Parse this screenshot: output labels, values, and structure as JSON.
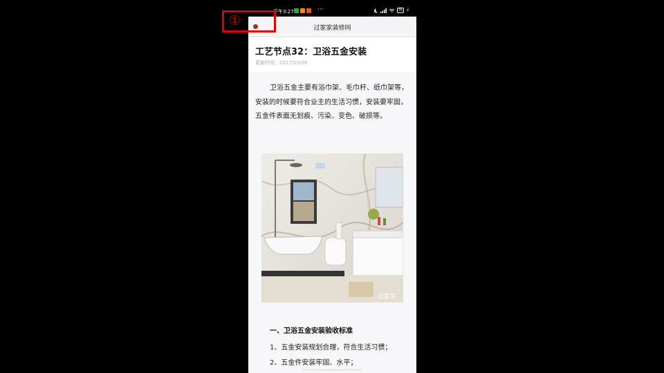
{
  "status_bar": {
    "time": "下午3:27",
    "more": "···",
    "battery": "35"
  },
  "title_bar": {
    "title": "过家家装修网"
  },
  "article": {
    "title": "工艺节点32：卫浴五金安装",
    "date": "更新时间：2017/10/26",
    "intro": "卫浴五金主要有浴巾架、毛巾杆、纸巾架等，安装的时候要符合业主的生活习惯，安装要牢固，五金件表面无划痕、污染、变色、破损等。",
    "image_watermark": "过家家",
    "section_heading": "一、卫浴五金安装验收标准",
    "items": [
      "1、五金安装规划合理，符合生活习惯；",
      "2、五金件安装牢固、水平；"
    ]
  },
  "annotation": {
    "marker": "①",
    "color": "#e00000"
  },
  "colors": {
    "back_dot": "#b02a20",
    "title_bar_bg": "#f4f4f6",
    "content_bg": "#f7f7f9"
  }
}
